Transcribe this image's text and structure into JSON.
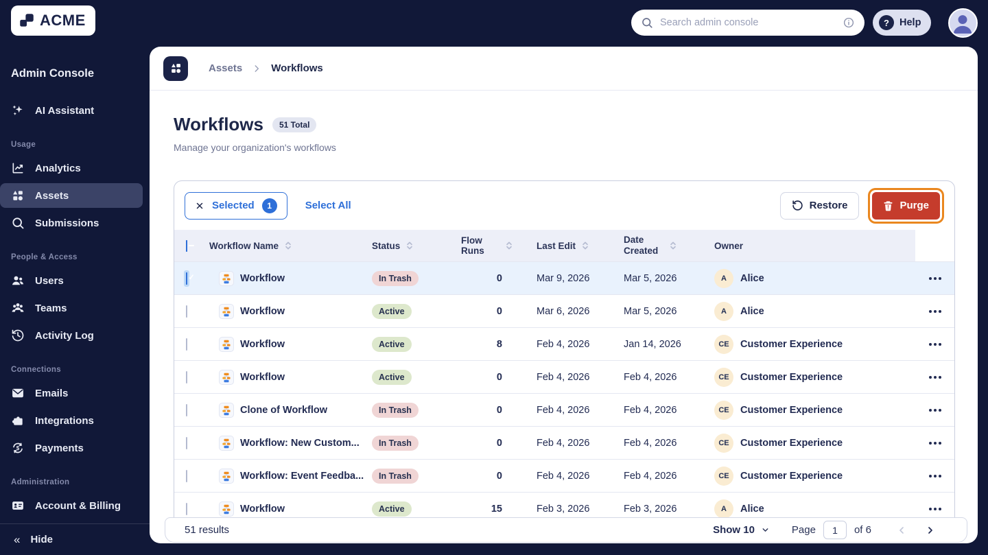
{
  "topbar": {
    "logo_text": "ACME",
    "search_placeholder": "Search admin console",
    "help_label": "Help"
  },
  "sidebar": {
    "title": "Admin Console",
    "assistant_label": "AI Assistant",
    "sections": [
      {
        "label": "Usage",
        "items": [
          {
            "label": "Analytics"
          },
          {
            "label": "Assets",
            "active": true
          },
          {
            "label": "Submissions"
          }
        ]
      },
      {
        "label": "People & Access",
        "items": [
          {
            "label": "Users"
          },
          {
            "label": "Teams"
          },
          {
            "label": "Activity Log"
          }
        ]
      },
      {
        "label": "Connections",
        "items": [
          {
            "label": "Emails"
          },
          {
            "label": "Integrations"
          },
          {
            "label": "Payments"
          }
        ]
      },
      {
        "label": "Administration",
        "items": [
          {
            "label": "Account & Billing"
          }
        ]
      }
    ],
    "hide_label": "Hide"
  },
  "breadcrumb": {
    "parent": "Assets",
    "current": "Workflows"
  },
  "page": {
    "title": "Workflows",
    "total_badge": "51 Total",
    "subtitle": "Manage your organization's workflows"
  },
  "toolbar": {
    "selected_label": "Selected",
    "selected_count": "1",
    "select_all_label": "Select All",
    "restore_label": "Restore",
    "purge_label": "Purge"
  },
  "table": {
    "columns": [
      "Workflow Name",
      "Status",
      "Flow Runs",
      "Last Edit",
      "Date Created",
      "Owner"
    ],
    "rows": [
      {
        "name": "Workflow",
        "status": "In Trash",
        "flow_runs": "0",
        "last_edit": "Mar 9, 2026",
        "date_created": "Mar 5, 2026",
        "owner_initials": "A",
        "owner_name": "Alice",
        "selected": true
      },
      {
        "name": "Workflow",
        "status": "Active",
        "flow_runs": "0",
        "last_edit": "Mar 6, 2026",
        "date_created": "Mar 5, 2026",
        "owner_initials": "A",
        "owner_name": "Alice",
        "selected": false
      },
      {
        "name": "Workflow",
        "status": "Active",
        "flow_runs": "8",
        "last_edit": "Feb 4, 2026",
        "date_created": "Jan 14, 2026",
        "owner_initials": "CE",
        "owner_name": "Customer Experience",
        "selected": false
      },
      {
        "name": "Workflow",
        "status": "Active",
        "flow_runs": "0",
        "last_edit": "Feb 4, 2026",
        "date_created": "Feb 4, 2026",
        "owner_initials": "CE",
        "owner_name": "Customer Experience",
        "selected": false
      },
      {
        "name": "Clone of Workflow",
        "status": "In Trash",
        "flow_runs": "0",
        "last_edit": "Feb 4, 2026",
        "date_created": "Feb 4, 2026",
        "owner_initials": "CE",
        "owner_name": "Customer Experience",
        "selected": false
      },
      {
        "name": "Workflow: New Custom...",
        "status": "In Trash",
        "flow_runs": "0",
        "last_edit": "Feb 4, 2026",
        "date_created": "Feb 4, 2026",
        "owner_initials": "CE",
        "owner_name": "Customer Experience",
        "selected": false
      },
      {
        "name": "Workflow: Event Feedba...",
        "status": "In Trash",
        "flow_runs": "0",
        "last_edit": "Feb 4, 2026",
        "date_created": "Feb 4, 2026",
        "owner_initials": "CE",
        "owner_name": "Customer Experience",
        "selected": false
      },
      {
        "name": "Workflow",
        "status": "Active",
        "flow_runs": "15",
        "last_edit": "Feb 3, 2026",
        "date_created": "Feb 3, 2026",
        "owner_initials": "A",
        "owner_name": "Alice",
        "selected": false
      }
    ]
  },
  "footer": {
    "results": "51 results",
    "show_label": "Show 10",
    "page_label": "Page",
    "page_value": "1",
    "of_label": "of 6"
  },
  "colors": {
    "sidebar_bg": "#111838",
    "accent_blue": "#2e6fd8",
    "purge_red": "#c53c2c",
    "highlight_orange": "#ea871f",
    "badge_trash_bg": "#f0d5d5",
    "badge_active_bg": "#dde8cc",
    "selected_row_bg": "#e9f2fd",
    "owner_avatar_bg": "#faecd2",
    "header_row_bg": "#edeff8"
  }
}
